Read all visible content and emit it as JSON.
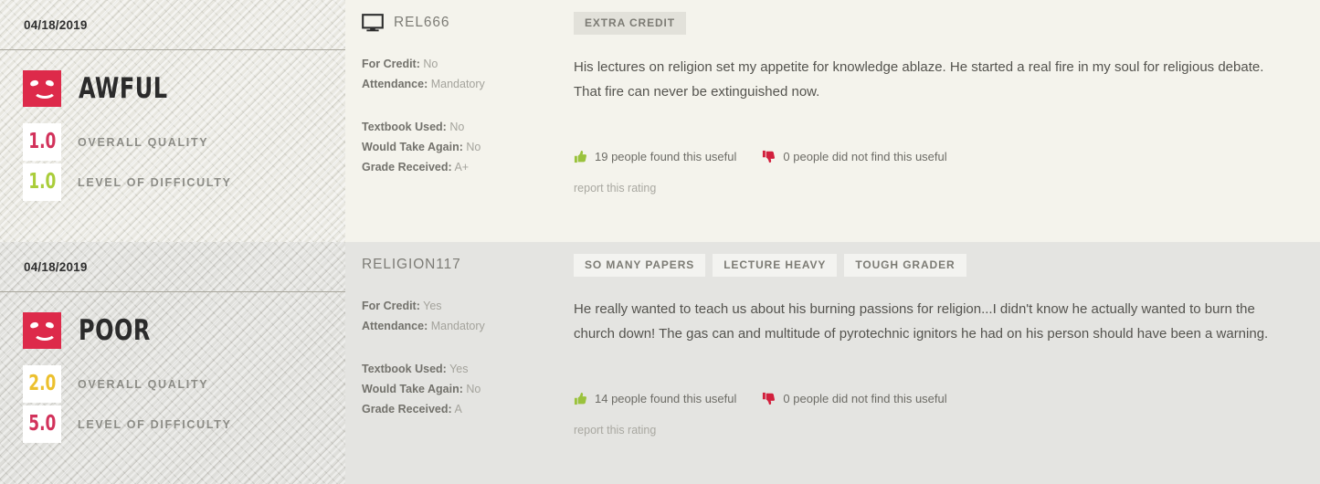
{
  "reviews": [
    {
      "date": "04/18/2019",
      "quality_word": "AWFUL",
      "emoji": "sad-face-icon",
      "overall_quality_value": "1.0",
      "overall_quality_label": "OVERALL QUALITY",
      "overall_quality_color": "#d2325b",
      "difficulty_value": "1.0",
      "difficulty_label": "LEVEL OF DIFFICULTY",
      "difficulty_color": "#aacd3a",
      "course_code": "REL666",
      "online_icon": "monitor-icon",
      "has_online_icon": true,
      "for_credit_label": "For Credit:",
      "for_credit_value": "No",
      "attendance_label": "Attendance:",
      "attendance_value": "Mandatory",
      "textbook_label": "Textbook Used:",
      "textbook_value": "No",
      "would_take_again_label": "Would Take Again:",
      "would_take_again_value": "No",
      "grade_label": "Grade Received:",
      "grade_value": "A+",
      "tags": [
        "EXTRA CREDIT"
      ],
      "comment": "His lectures on religion set my appetite for knowledge ablaze. He started a real fire in my soul for religious debate. That fire can never be extinguished now.",
      "helpful_text": "19 people found this useful",
      "not_helpful_text": "0 people did not find this useful",
      "report_label": "report this rating"
    },
    {
      "date": "04/18/2019",
      "quality_word": "POOR",
      "emoji": "sad-face-icon",
      "overall_quality_value": "2.0",
      "overall_quality_label": "OVERALL QUALITY",
      "overall_quality_color": "#ecc02e",
      "difficulty_value": "5.0",
      "difficulty_label": "LEVEL OF DIFFICULTY",
      "difficulty_color": "#d2325b",
      "course_code": "RELIGION117",
      "online_icon": "",
      "has_online_icon": false,
      "for_credit_label": "For Credit:",
      "for_credit_value": "Yes",
      "attendance_label": "Attendance:",
      "attendance_value": "Mandatory",
      "textbook_label": "Textbook Used:",
      "textbook_value": "Yes",
      "would_take_again_label": "Would Take Again:",
      "would_take_again_value": "No",
      "grade_label": "Grade Received:",
      "grade_value": "A",
      "tags": [
        "SO MANY PAPERS",
        "LECTURE HEAVY",
        "TOUGH GRADER"
      ],
      "comment": "He really wanted to teach us about his burning passions for religion...I didn't know he actually wanted to burn the church down! The gas can and multitude of pyrotechnic ignitors he had on his person should have been a warning.",
      "helpful_text": "14 people found this useful",
      "not_helpful_text": "0 people did not find this useful",
      "report_label": "report this rating"
    }
  ],
  "colors": {
    "accent_red": "#dd2a4a",
    "thumb_up_green": "#9ac23c",
    "thumb_down_red": "#d2203d",
    "panel_light": "#f4f3ec",
    "panel_dark": "#e4e4e1"
  }
}
